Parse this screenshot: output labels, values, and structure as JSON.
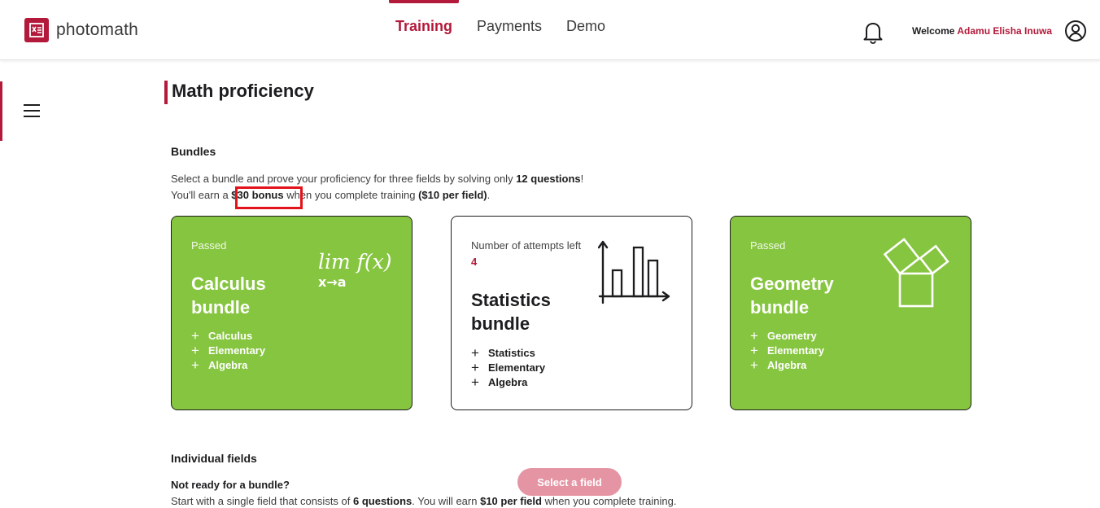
{
  "header": {
    "logo_text": "photomath",
    "nav": [
      "Training",
      "Payments",
      "Demo"
    ],
    "welcome_label": "Welcome",
    "user_name": "Adamu Elisha Inuwa",
    "accent_color": "#b3193a"
  },
  "page": {
    "title": "Math proficiency"
  },
  "bundles": {
    "heading": "Bundles",
    "line1_pre": "Select a bundle and prove your proficiency for three fields by solving only ",
    "line1_bold": "12 questions",
    "line1_post": "!",
    "line2_pre": "You'll earn a ",
    "line2_bonus": "$30 bonus",
    "line2_mid": " when you complete training ",
    "line2_bold": "($10 per field)",
    "line2_post": ".",
    "cards": [
      {
        "status": "Passed",
        "title_1": "Calculus",
        "title_2": "bundle",
        "items": [
          "Calculus",
          "Elementary",
          "Algebra"
        ],
        "color": "#86c53f",
        "art_top": "lim f(x)",
        "art_bottom": "x→a"
      },
      {
        "status_label": "Number of attempts left",
        "attempts_left": "4",
        "title_1": "Statistics",
        "title_2": "bundle",
        "items": [
          "Statistics",
          "Elementary",
          "Algebra"
        ],
        "color": "#ffffff",
        "art": "bar-chart-icon"
      },
      {
        "status": "Passed",
        "title_1": "Geometry",
        "title_2": "bundle",
        "items": [
          "Geometry",
          "Elementary",
          "Algebra"
        ],
        "color": "#86c53f",
        "art": "pythagoras-squares-icon"
      }
    ]
  },
  "individual": {
    "heading": "Individual fields",
    "subheading": "Not ready for a bundle?",
    "line_pre": "Start with a single field that consists of ",
    "line_bold1": "6 questions",
    "line_mid": ". You will earn ",
    "line_bold2": "$10 per field",
    "line_post": " when you complete training.",
    "button_label": "Select a field"
  }
}
